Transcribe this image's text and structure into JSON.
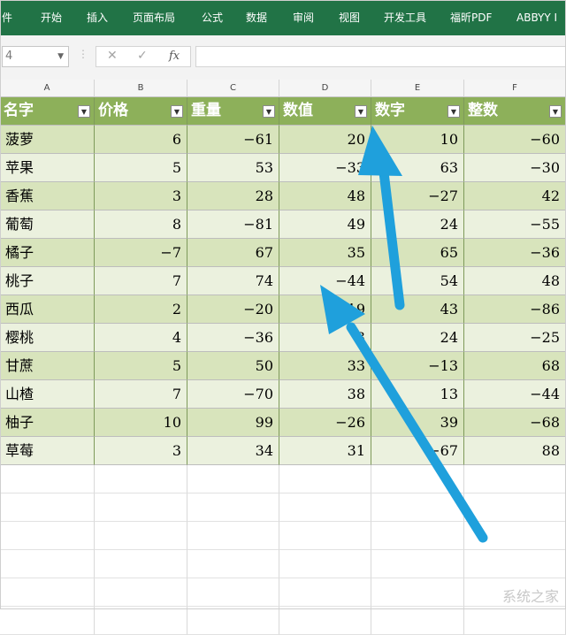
{
  "ribbon": {
    "tabs": [
      "件",
      "开始",
      "插入",
      "页面布局",
      "公式",
      "数据",
      "审阅",
      "视图",
      "开发工具",
      "福昕PDF",
      "ABBYY I"
    ]
  },
  "formula_bar": {
    "name_box": "4",
    "cancel_symbol": "✕",
    "enter_symbol": "✓",
    "fx_symbol": "fx",
    "formula": ""
  },
  "sheet": {
    "column_letters": [
      "A",
      "B",
      "C",
      "D",
      "E",
      "F"
    ],
    "headers": [
      "名字",
      "价格",
      "重量",
      "数值",
      "数字",
      "整数"
    ],
    "rows": [
      [
        "菠萝",
        "6",
        "−61",
        "20",
        "10",
        "−60"
      ],
      [
        "苹果",
        "5",
        "53",
        "−33",
        "63",
        "−30"
      ],
      [
        "香蕉",
        "3",
        "28",
        "48",
        "−27",
        "42"
      ],
      [
        "葡萄",
        "8",
        "−81",
        "49",
        "24",
        "−55"
      ],
      [
        "橘子",
        "−7",
        "67",
        "35",
        "65",
        "−36"
      ],
      [
        "桃子",
        "7",
        "74",
        "−44",
        "54",
        "48"
      ],
      [
        "西瓜",
        "2",
        "−20",
        "19",
        "43",
        "−86"
      ],
      [
        "樱桃",
        "4",
        "−36",
        "3",
        "24",
        "−25"
      ],
      [
        "甘蔗",
        "5",
        "50",
        "33",
        "−13",
        "68"
      ],
      [
        "山楂",
        "7",
        "−70",
        "38",
        "13",
        "−44"
      ],
      [
        "柚子",
        "10",
        "99",
        "−26",
        "39",
        "−68"
      ],
      [
        "草莓",
        "3",
        "34",
        "31",
        "−67",
        "88"
      ]
    ]
  },
  "colors": {
    "ribbon": "#217346",
    "header_fill": "#8db05a",
    "band_dark": "#d8e4bc",
    "band_light": "#ebf1de",
    "arrow": "#1fa0dc"
  },
  "icons": {
    "filter": "filter-dropdown-icon",
    "namebox_caret": "chevron-down-icon"
  },
  "watermark": "系统之家"
}
